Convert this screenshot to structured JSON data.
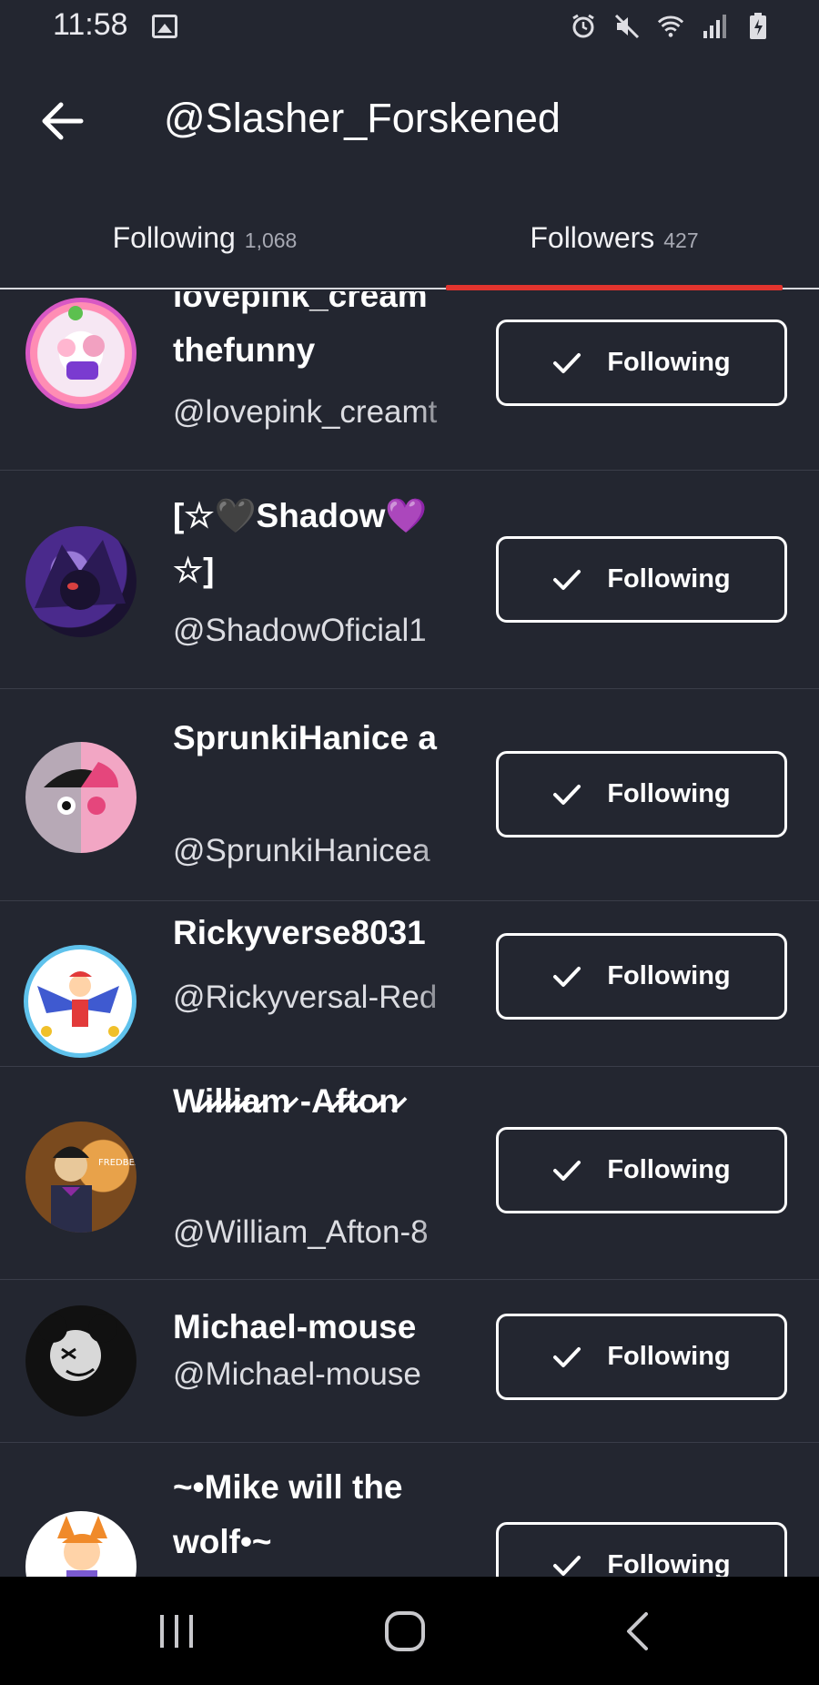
{
  "status": {
    "time": "11:58",
    "icons": [
      "gallery-icon",
      "alarm-icon",
      "mute-icon",
      "wifi-icon",
      "signal-icon",
      "battery-icon"
    ]
  },
  "header": {
    "title": "@Slasher_Forskened",
    "back_icon": "back-arrow-icon"
  },
  "tabs": [
    {
      "label": "Following",
      "count": "1,068",
      "active": false
    },
    {
      "label": "Followers",
      "count": "427",
      "active": true
    }
  ],
  "accent": "#e2342e",
  "users": [
    {
      "name": "lovepink_cream thefunny",
      "handle": "@lovepink_creamt",
      "button": "Following",
      "avatar_colors": [
        "#d858c4",
        "#f6e7f3",
        "#ff8db4"
      ]
    },
    {
      "name": "[☆🖤Shadow💜 ☆]",
      "handle": "@ShadowOficial1",
      "button": "Following",
      "avatar_colors": [
        "#4a2a8c",
        "#1a1230",
        "#9a7ad8"
      ]
    },
    {
      "name": "SprunkiHanice a",
      "handle": "@SprunkiHanicea",
      "button": "Following",
      "avatar_colors": [
        "#1a1a1a",
        "#e5467c",
        "#f2a6c4"
      ]
    },
    {
      "name": "Rickyverse8031",
      "handle": "@Rickyversal-Red",
      "button": "Following",
      "avatar_colors": [
        "#5fc2ec",
        "#ffffff",
        "#e23a3a"
      ]
    },
    {
      "name": "W̷i̷l̷l̷i̷a̷m̷ -A̷f̷t̷o̷n̷",
      "handle": "@William_Afton-8",
      "button": "Following",
      "avatar_colors": [
        "#7a4a1e",
        "#2a2d4a",
        "#e8c89a"
      ]
    },
    {
      "name": "Michael-mouse",
      "handle": "@Michael-mouse",
      "button": "Following",
      "avatar_colors": [
        "#111111",
        "#d8d8d8",
        "#555555"
      ]
    },
    {
      "name": "~•Mike will the wolf•~",
      "handle": "",
      "button": "Following",
      "avatar_colors": [
        "#ffffff",
        "#f08a2a",
        "#7a5ad0"
      ]
    }
  ],
  "nav": {
    "recents": "recents-icon",
    "home": "home-icon",
    "back": "nav-back-icon"
  }
}
